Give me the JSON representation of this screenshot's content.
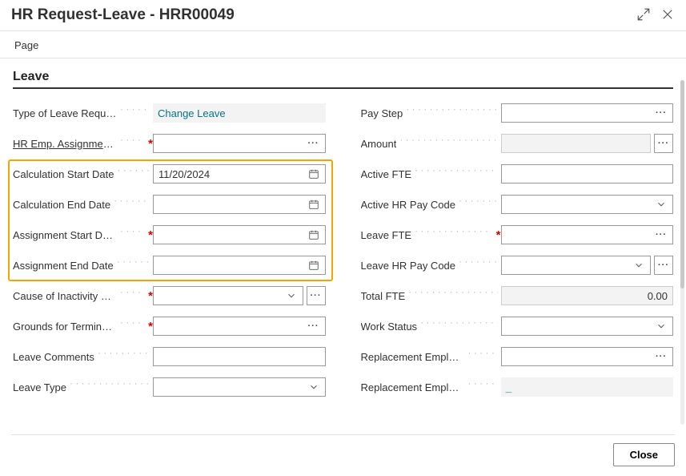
{
  "header": {
    "title": "HR Request-Leave - HRR00049"
  },
  "tab": "Page",
  "section_title": "Leave",
  "left": {
    "type_of_leave_label": "Type of Leave Request",
    "type_of_leave_value": "Change Leave",
    "hr_emp_assignment_label": "HR Emp. Assignment …",
    "calc_start_label": "Calculation Start Date",
    "calc_start_value": "11/20/2024",
    "calc_end_label": "Calculation End Date",
    "assign_start_label": "Assignment Start Date",
    "assign_end_label": "Assignment End Date",
    "cause_inactivity_label": "Cause of Inactivity Co…",
    "grounds_term_label": "Grounds for Terminati…",
    "leave_comments_label": "Leave Comments",
    "leave_type_label": "Leave Type"
  },
  "right": {
    "pay_step_label": "Pay Step",
    "amount_label": "Amount",
    "active_fte_label": "Active FTE",
    "active_hr_pay_label": "Active HR Pay Code",
    "leave_fte_label": "Leave FTE",
    "leave_hr_pay_label": "Leave HR Pay Code",
    "total_fte_label": "Total FTE",
    "total_fte_value": "0.00",
    "work_status_label": "Work Status",
    "replacement_emp1_label": "Replacement Employe…",
    "replacement_emp2_label": "Replacement Employe…",
    "replacement_emp2_value": "_"
  },
  "footer": {
    "close": "Close"
  }
}
